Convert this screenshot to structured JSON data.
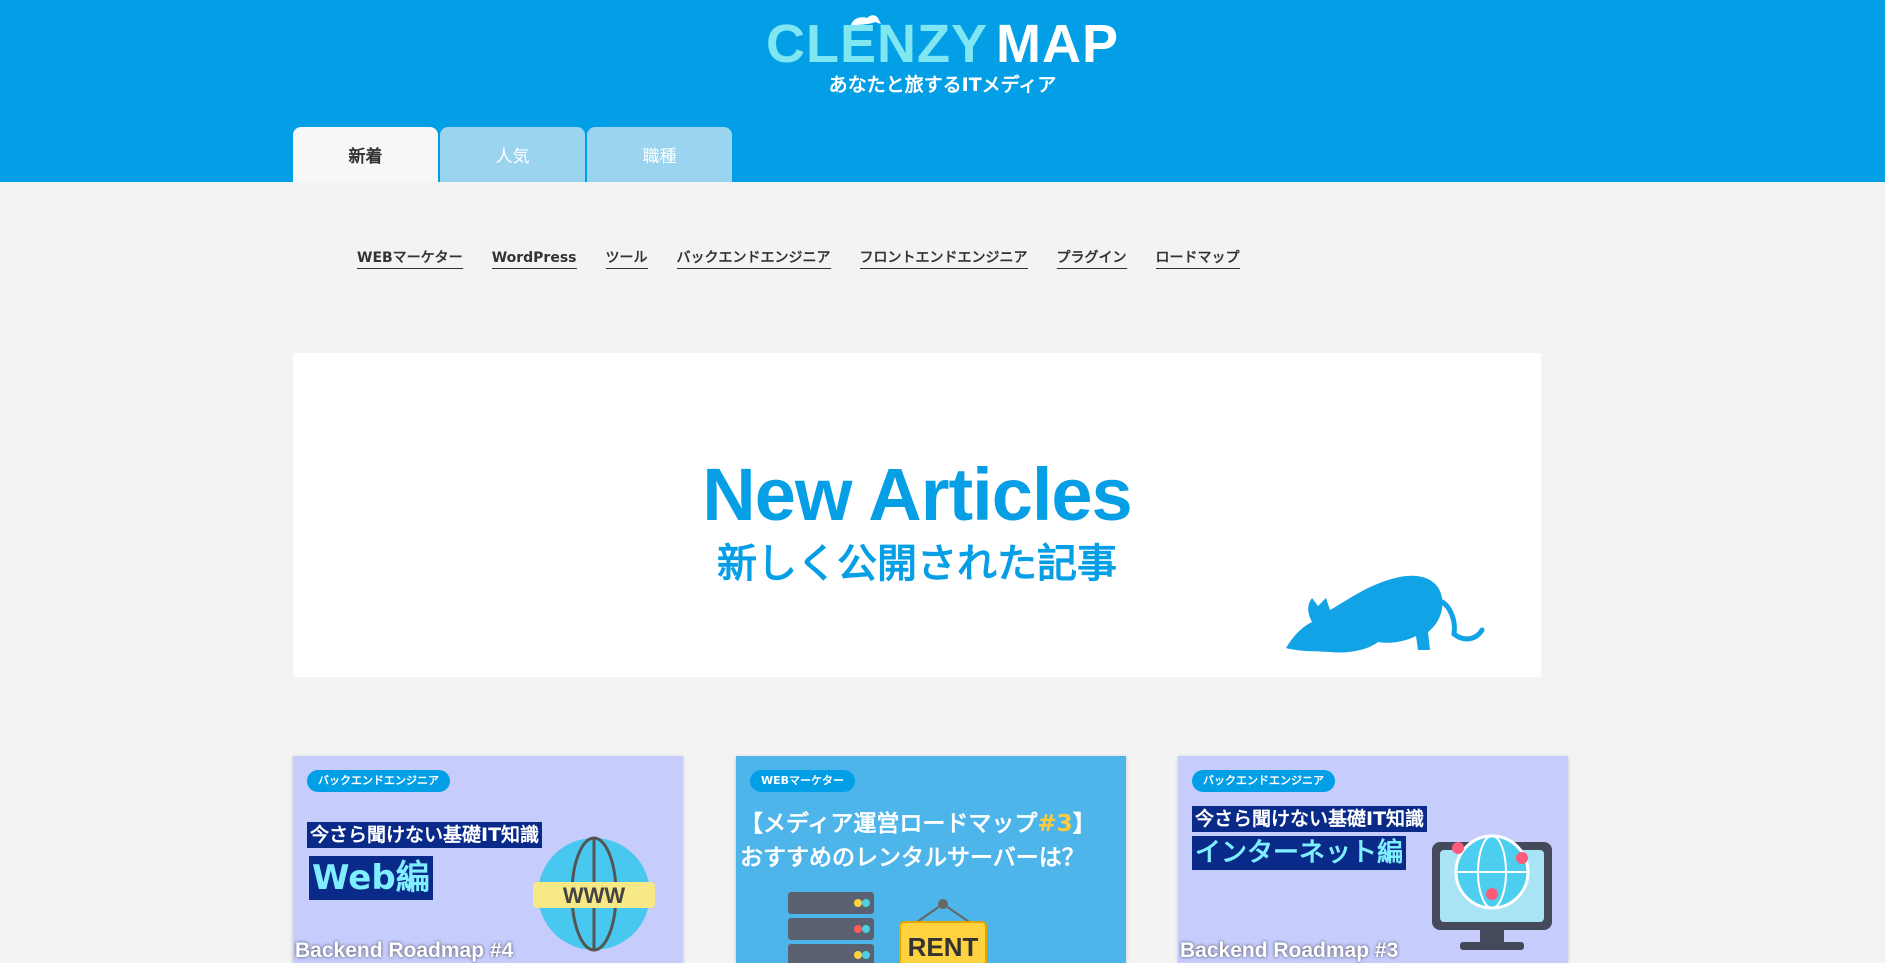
{
  "header": {
    "logo_part1": "CLENZY",
    "logo_part2": "MAP",
    "tagline": "あなたと旅するITメディア"
  },
  "tabs": [
    {
      "label": "新着",
      "active": true
    },
    {
      "label": "人気",
      "active": false
    },
    {
      "label": "職種",
      "active": false
    }
  ],
  "categories": [
    "WEBマーケター",
    "WordPress",
    "ツール",
    "バックエンドエンジニア",
    "フロントエンドエンジニア",
    "プラグイン",
    "ロードマップ"
  ],
  "banner": {
    "title": "New Articles",
    "subtitle": "新しく公開された記事"
  },
  "cards": [
    {
      "badge": "バックエンドエンジニア",
      "line1": "今さら聞けない基礎IT知識",
      "line2": "Web編",
      "icon_text": "WWW",
      "footer": "Backend Roadmap #4"
    },
    {
      "badge": "WEBマーケター",
      "line1_a": "【メディア運営ロードマップ",
      "line1_b": "#3",
      "line1_c": "】",
      "line2": "おすすめのレンタルサーバーは？",
      "sign_text": "RENT"
    },
    {
      "badge": "バックエンドエンジニア",
      "line1": "今さら聞けない基礎IT知識",
      "line2": "インターネット編",
      "footer": "Backend Roadmap #3"
    }
  ],
  "colors": {
    "brand": "#039fe6",
    "logo_accent": "#7fe6f2",
    "tab_inactive": "#9bd4ef",
    "card_lavender": "#c6ccfc",
    "card_blue": "#4db5ea"
  }
}
